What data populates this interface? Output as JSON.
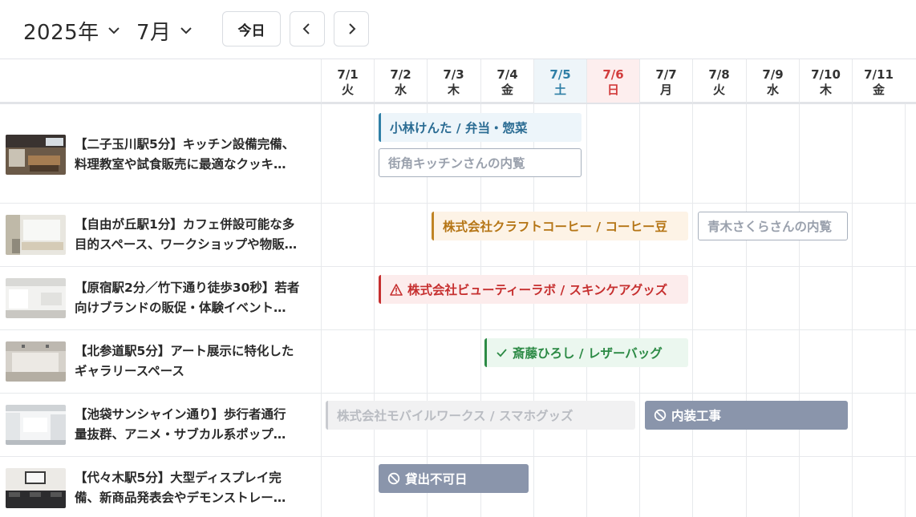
{
  "toolbar": {
    "year_label": "2025年",
    "month_label": "7月",
    "today_label": "今日",
    "prev_icon": "chevron-left-icon",
    "next_icon": "chevron-right-icon"
  },
  "days": [
    {
      "date": "7/1",
      "weekday": "火",
      "type": "weekday"
    },
    {
      "date": "7/2",
      "weekday": "水",
      "type": "weekday"
    },
    {
      "date": "7/3",
      "weekday": "木",
      "type": "weekday"
    },
    {
      "date": "7/4",
      "weekday": "金",
      "type": "weekday"
    },
    {
      "date": "7/5",
      "weekday": "土",
      "type": "saturday"
    },
    {
      "date": "7/6",
      "weekday": "日",
      "type": "sunday"
    },
    {
      "date": "7/7",
      "weekday": "月",
      "type": "weekday"
    },
    {
      "date": "7/8",
      "weekday": "火",
      "type": "weekday"
    },
    {
      "date": "7/9",
      "weekday": "水",
      "type": "weekday"
    },
    {
      "date": "7/10",
      "weekday": "木",
      "type": "weekday"
    },
    {
      "date": "7/11",
      "weekday": "金",
      "type": "weekday"
    }
  ],
  "spaces": [
    {
      "line1": "【二子玉川駅5分】キッチン設備完備、",
      "line2": "料理教室や試食販売に最適なクッキ…",
      "events": [
        {
          "label": "小林けんた / 弁当・惣菜",
          "style": "blue",
          "icon": ""
        },
        {
          "label": "街角キッチンさんの内覧",
          "style": "outline",
          "icon": ""
        }
      ]
    },
    {
      "line1": "【自由が丘駅1分】カフェ併設可能な多",
      "line2": "目的スペース、ワークショップや物販…",
      "events": [
        {
          "label": "株式会社クラフトコーヒー / コーヒー豆",
          "style": "orange",
          "icon": ""
        },
        {
          "label": "青木さくらさんの内覧",
          "style": "outline",
          "icon": ""
        }
      ]
    },
    {
      "line1": "【原宿駅2分／竹下通り徒歩30秒】若者",
      "line2": "向けブランドの販促・体験イベント…",
      "events": [
        {
          "label": "株式会社ビューティーラボ / スキンケアグッズ",
          "style": "red",
          "icon": "warning-icon"
        }
      ]
    },
    {
      "line1": "【北参道駅5分】アート展示に特化した",
      "line2": "ギャラリースペース",
      "events": [
        {
          "label": "斎藤ひろし / レザーバッグ",
          "style": "green",
          "icon": "check-icon"
        }
      ]
    },
    {
      "line1": "【池袋サンシャイン通り】歩行者通行",
      "line2": "量抜群、アニメ・サブカル系ポップ…",
      "events": [
        {
          "label": "株式会社モバイルワークス / スマホグッズ",
          "style": "gray",
          "icon": ""
        },
        {
          "label": "内装工事",
          "style": "block",
          "icon": "block-icon"
        }
      ]
    },
    {
      "line1": "【代々木駅5分】大型ディスプレイ完",
      "line2": "備、新商品発表会やデモンストレー…",
      "events": [
        {
          "label": "貸出不可日",
          "style": "block",
          "icon": "block-icon"
        }
      ]
    }
  ]
}
